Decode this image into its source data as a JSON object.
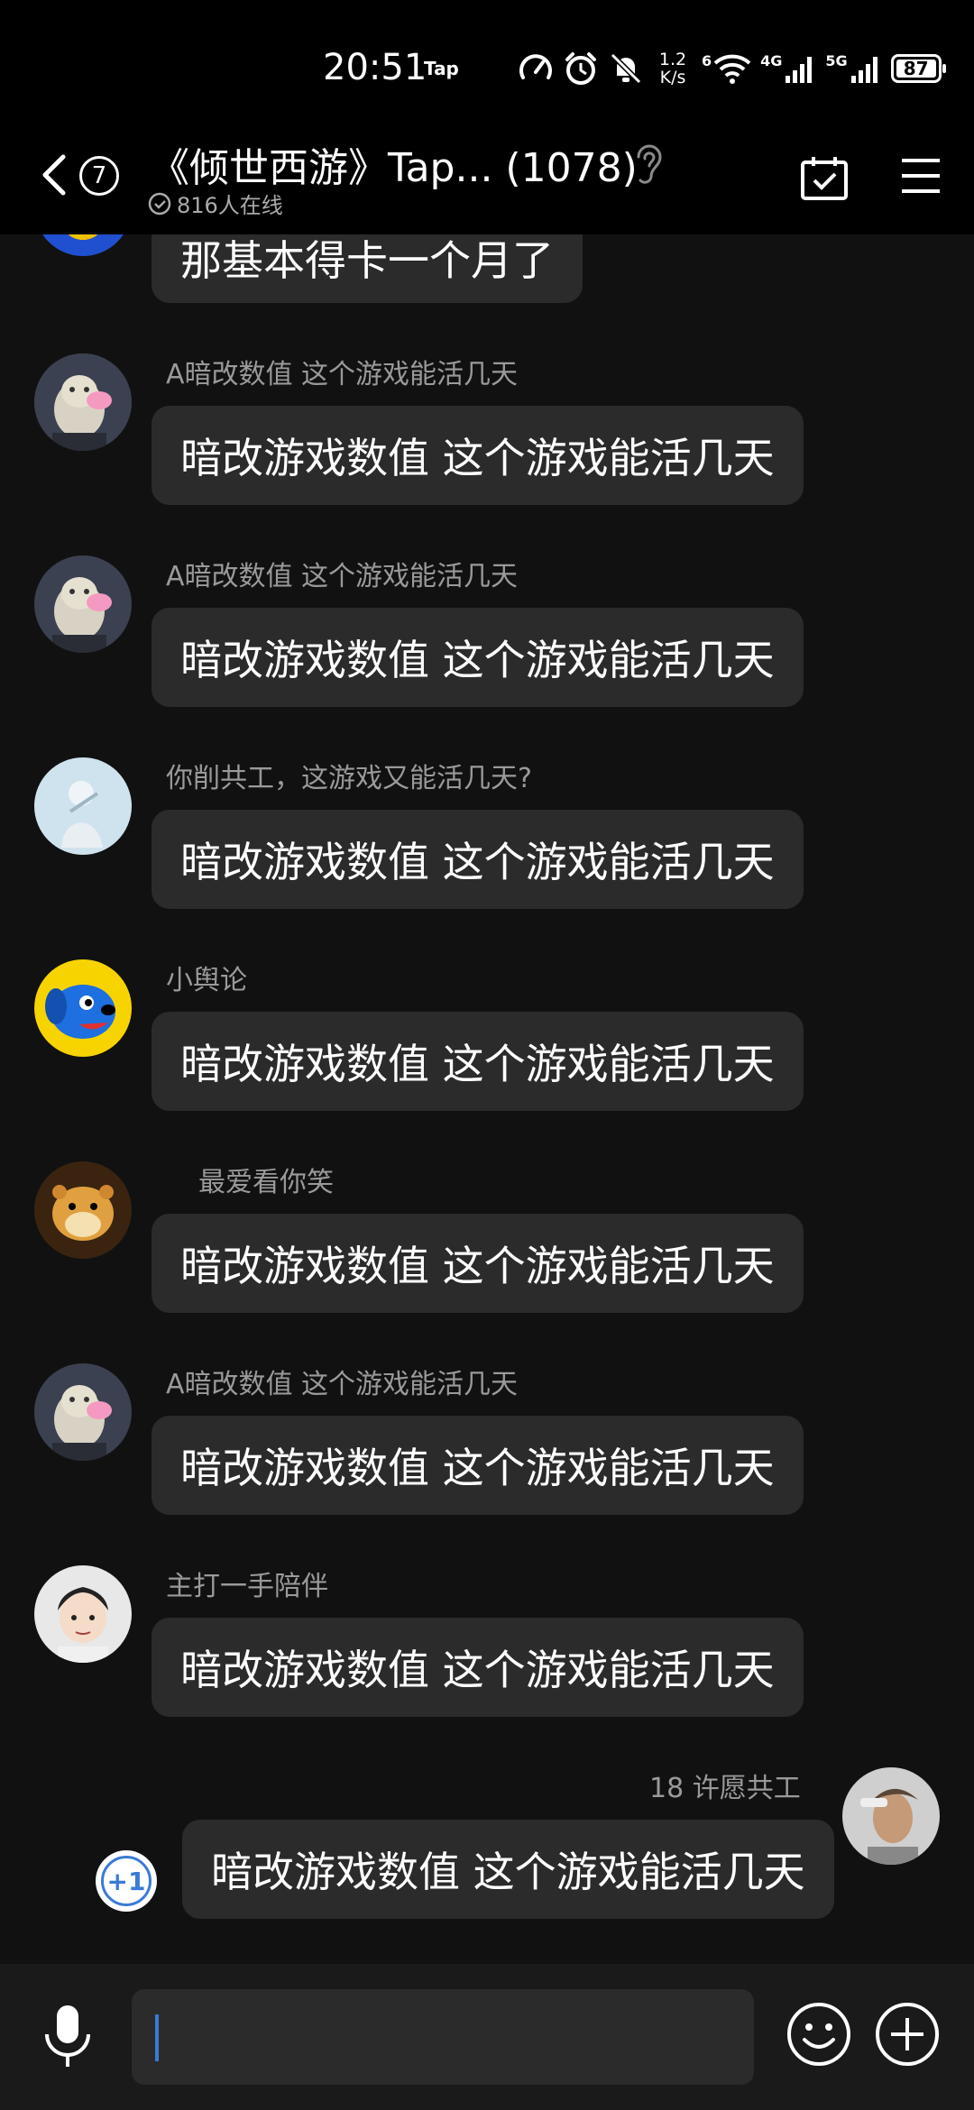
{
  "status_bar": {
    "time": "20:51",
    "app_tag": "Tap",
    "net_speed_value": "1.2",
    "net_speed_unit": "K/s",
    "wifi_tag": "6",
    "signal1_tag": "4G",
    "signal2_tag": "5G",
    "battery": "87"
  },
  "header": {
    "unread_count": "7",
    "title": "《倾世西游》Tap...  (1078)",
    "online": "816人在线"
  },
  "messages": [
    {
      "sender": "",
      "text": "那基本得卡一个月了"
    },
    {
      "sender": "A暗改数值 这个游戏能活几天",
      "text": "暗改游戏数值 这个游戏能活几天"
    },
    {
      "sender": "A暗改数值 这个游戏能活几天",
      "text": "暗改游戏数值 这个游戏能活几天"
    },
    {
      "sender": "你削共工，这游戏又能活几天?",
      "text": "暗改游戏数值 这个游戏能活几天"
    },
    {
      "sender": "小舆论",
      "text": "暗改游戏数值 这个游戏能活几天"
    },
    {
      "sender": "最爱看你笑",
      "text": "暗改游戏数值 这个游戏能活几天"
    },
    {
      "sender": "A暗改数值 这个游戏能活几天",
      "text": "暗改游戏数值 这个游戏能活几天"
    },
    {
      "sender": "主打一手陪伴",
      "text": "暗改游戏数值 这个游戏能活几天"
    },
    {
      "sender": "18 许愿共工",
      "text": "暗改游戏数值 这个游戏能活几天"
    }
  ],
  "plus_one": "+1",
  "input": {
    "placeholder": "",
    "value": ""
  },
  "colors": {
    "background": "#111111",
    "bubble": "#2b2b2b",
    "accent": "#3a7bd5",
    "secondary_text": "#9a9a9a"
  },
  "icons": [
    "back-icon",
    "ear-icon",
    "calendar-check-icon",
    "menu-icon",
    "microphone-icon",
    "emoji-icon",
    "plus-circle-icon"
  ]
}
